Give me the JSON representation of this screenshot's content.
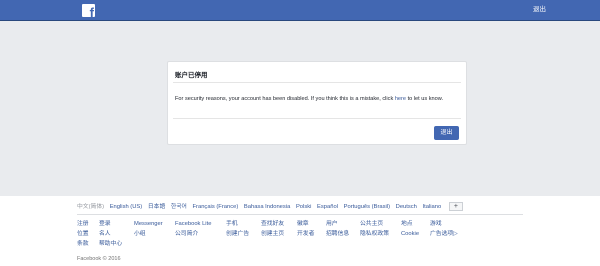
{
  "topbar": {
    "logo": "f",
    "logout_label": "退出",
    "bg_color": "#4267b2"
  },
  "card": {
    "title": "账户已停用",
    "message_before": "For security reasons, your account has been disabled. If you think this is a mistake, click ",
    "message_link": "here",
    "message_after": " to let us know.",
    "button_label": "退出"
  },
  "footer": {
    "languages": [
      "中文(简体)",
      "English (US)",
      "日本語",
      "한국어",
      "Français (France)",
      "Bahasa Indonesia",
      "Polski",
      "Español",
      "Português (Brasil)",
      "Deutsch",
      "Italiano"
    ],
    "more_languages": "+",
    "links": [
      [
        "注册",
        "登录",
        "Messenger",
        "Facebook Lite",
        "手机",
        "查找好友",
        "徽章",
        "用户",
        "公共主页",
        "地点",
        "游戏"
      ],
      [
        "位置",
        "名人",
        "小组",
        "公司简介",
        "创建广告",
        "创建主页",
        "开发者",
        "招聘信息",
        "隐私权政策",
        "Cookie",
        "广告选项"
      ],
      [
        "条款",
        "帮助中心"
      ]
    ],
    "copyright": "Facebook © 2016"
  }
}
